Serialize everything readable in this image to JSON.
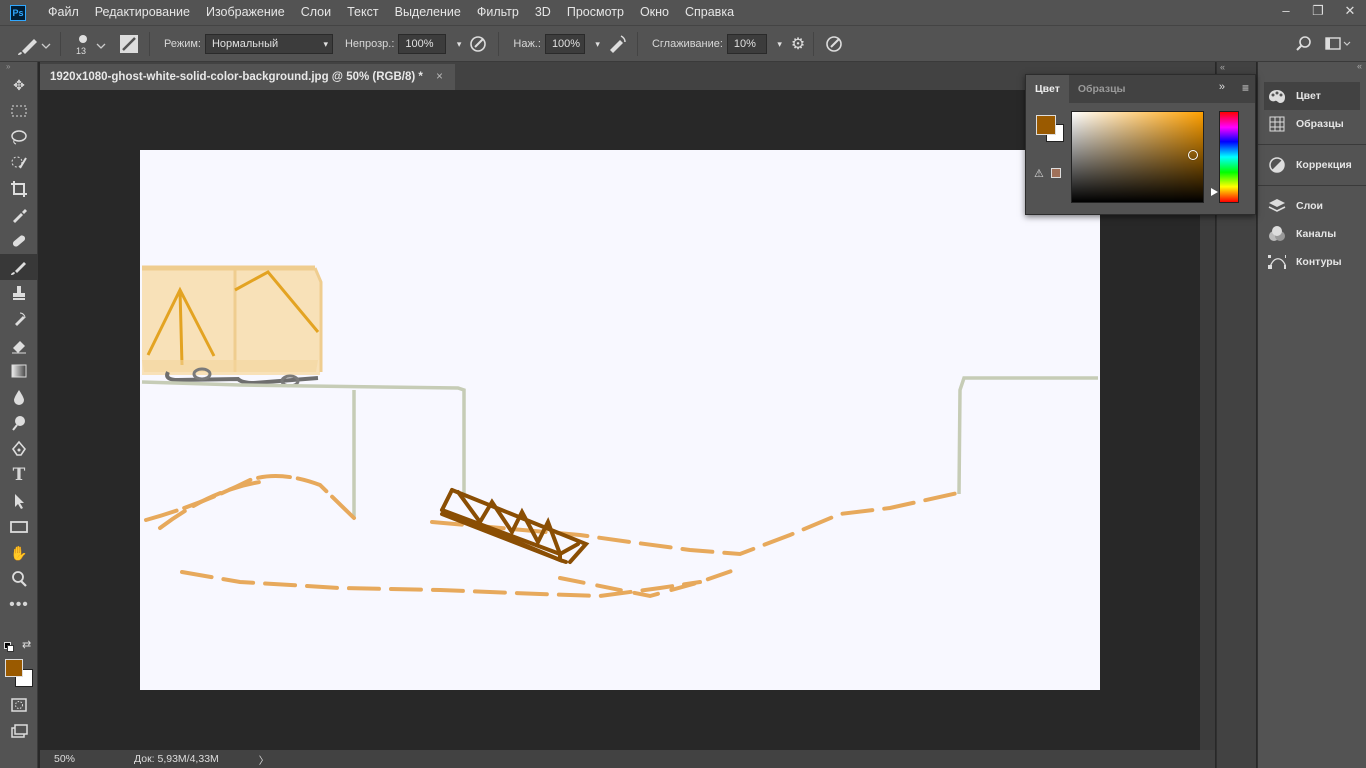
{
  "app": {
    "logo": "Ps"
  },
  "menu": [
    "Файл",
    "Редактирование",
    "Изображение",
    "Слои",
    "Текст",
    "Выделение",
    "Фильтр",
    "3D",
    "Просмотр",
    "Окно",
    "Справка"
  ],
  "window_controls": {
    "minimize": "–",
    "restore": "❐",
    "close": "✕"
  },
  "options": {
    "brush_size": "13",
    "mode_label": "Режим:",
    "mode_value": "Нормальный",
    "opacity_label": "Непрозр.:",
    "opacity_value": "100%",
    "pressure_label": "Наж.:",
    "pressure_value": "100%",
    "smoothing_label": "Сглаживание:",
    "smoothing_value": "10%"
  },
  "document": {
    "tab_title": "1920x1080-ghost-white-solid-color-background.jpg @ 50% (RGB/8) *",
    "close": "×",
    "background_color": "#f8f8ff"
  },
  "status": {
    "zoom": "50%",
    "doc_size": "Док: 5,93M/4,33M",
    "arrow": "〉"
  },
  "color_panel": {
    "tabs": [
      "Цвет",
      "Образцы"
    ],
    "foreground": "#9a5a00",
    "background": "#ffffff"
  },
  "dock": {
    "items": [
      {
        "label": "Цвет",
        "icon": "palette-icon"
      },
      {
        "label": "Образцы",
        "icon": "swatches-grid-icon"
      },
      {
        "label": "Коррекция",
        "icon": "adjustments-icon"
      },
      {
        "label": "Слои",
        "icon": "layers-icon"
      },
      {
        "label": "Каналы",
        "icon": "channels-icon"
      },
      {
        "label": "Контуры",
        "icon": "paths-icon"
      }
    ]
  },
  "colors": {
    "foreground": "#9a5a00",
    "background": "#ffffff",
    "ui_dark": "#535353"
  }
}
